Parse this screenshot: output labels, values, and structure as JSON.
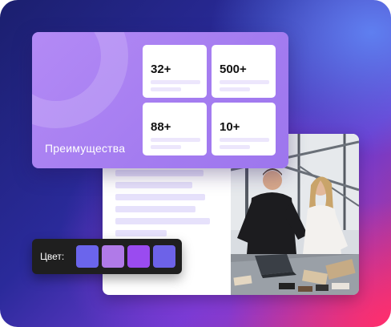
{
  "stats_card": {
    "title": "Преимущества",
    "tiles": [
      {
        "value": "32+"
      },
      {
        "value": "500+"
      },
      {
        "value": "88+"
      },
      {
        "value": "10+"
      }
    ]
  },
  "color_picker": {
    "label": "Цвет:",
    "swatches": [
      "#6b65ec",
      "#b07ae8",
      "#9a4bf0",
      "#6d62e8"
    ]
  },
  "doc_card": {
    "photo": "team-working-at-table-photo"
  },
  "colors": {
    "card_accent": "#a47cf0",
    "line_placeholder": "#e6e1fb"
  }
}
